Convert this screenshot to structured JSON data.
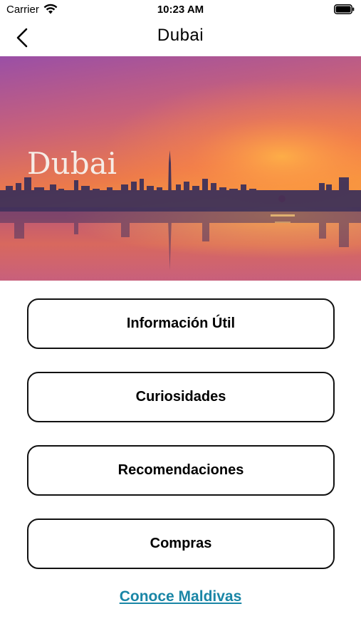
{
  "status_bar": {
    "carrier": "Carrier",
    "time": "10:23 AM",
    "wifi_icon": "wifi-icon",
    "battery_icon": "battery-icon"
  },
  "nav": {
    "title": "Dubai",
    "back_icon": "chevron-left-icon"
  },
  "hero": {
    "title": "Dubai",
    "image": "dubai-skyline-sunset"
  },
  "menu": {
    "items": [
      {
        "label": "Información Útil"
      },
      {
        "label": "Curiosidades"
      },
      {
        "label": "Recomendaciones"
      },
      {
        "label": "Compras"
      }
    ]
  },
  "footer_link": {
    "label": "Conoce Maldivas",
    "color": "#1a86a6"
  }
}
